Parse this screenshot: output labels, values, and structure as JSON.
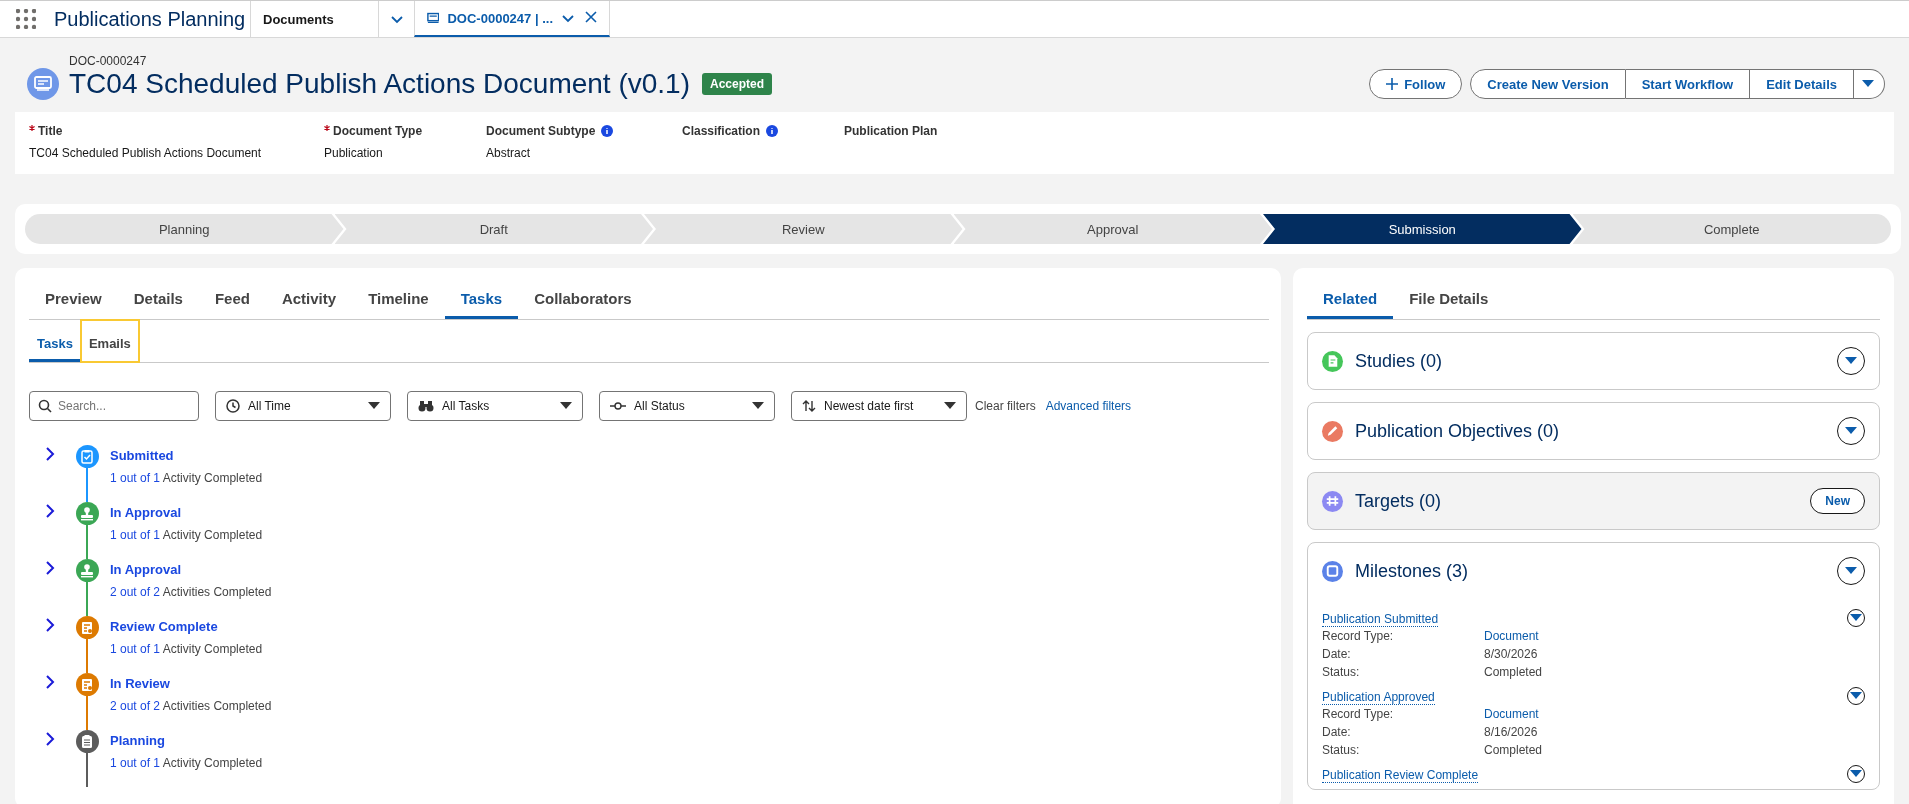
{
  "app": {
    "name": "Publications Planning",
    "nav_tabs": [
      {
        "label": "Documents",
        "kind": "object",
        "selected": false
      },
      {
        "label": "DOC-0000247 | ...",
        "kind": "record",
        "selected": true
      }
    ]
  },
  "header": {
    "record_id": "DOC-0000247",
    "title": "TC04 Scheduled Publish Actions Document (v0.1)",
    "badge": "Accepted",
    "follow": "Follow",
    "actions": [
      "Create New Version",
      "Start Workflow",
      "Edit Details"
    ]
  },
  "fields": [
    {
      "label": "Title",
      "required": true,
      "info": false,
      "value": "TC04 Scheduled Publish Actions Document"
    },
    {
      "label": "Document Type",
      "required": true,
      "info": false,
      "value": "Publication"
    },
    {
      "label": "Document Subtype",
      "required": false,
      "info": true,
      "value": "Abstract"
    },
    {
      "label": "Classification",
      "required": false,
      "info": true
    },
    {
      "label": "Publication Plan",
      "required": false,
      "info": false
    }
  ],
  "path": [
    {
      "label": "Planning",
      "selected": false
    },
    {
      "label": "Draft",
      "selected": false
    },
    {
      "label": "Review",
      "selected": false
    },
    {
      "label": "Approval",
      "selected": false
    },
    {
      "label": "Submission",
      "selected": true
    },
    {
      "label": "Complete",
      "selected": false
    }
  ],
  "main_tabs": [
    {
      "label": "Preview",
      "selected": false
    },
    {
      "label": "Details",
      "selected": false
    },
    {
      "label": "Feed",
      "selected": false
    },
    {
      "label": "Activity",
      "selected": false
    },
    {
      "label": "Timeline",
      "selected": false
    },
    {
      "label": "Tasks",
      "selected": true
    },
    {
      "label": "Collaborators",
      "selected": false
    }
  ],
  "sub_tabs": [
    {
      "label": "Tasks",
      "selected": true,
      "focused": false
    },
    {
      "label": "Emails",
      "selected": false,
      "focused": true
    }
  ],
  "filters": {
    "search": {
      "placeholder": "Search..."
    },
    "dropdowns": [
      {
        "kind": "time",
        "value": "All Time"
      },
      {
        "kind": "tasks",
        "value": "All Tasks"
      },
      {
        "kind": "status",
        "value": "All Status"
      },
      {
        "kind": "sort",
        "value": "Newest date first"
      }
    ],
    "clear": "Clear filters",
    "advanced": "Advanced filters"
  },
  "timeline": [
    {
      "kind": "submitted",
      "color": "#1b96ff",
      "title": "Submitted",
      "count": "1 out of 1",
      "summary": "Activity Completed"
    },
    {
      "kind": "approval",
      "color": "#3ba755",
      "title": "In Approval",
      "count": "1 out of 1",
      "summary": "Activity Completed"
    },
    {
      "kind": "approval",
      "color": "#3ba755",
      "title": "In Approval",
      "count": "2 out of 2",
      "summary": "Activities Completed"
    },
    {
      "kind": "review",
      "color": "#dd7a01",
      "title": "Review Complete",
      "count": "1 out of 1",
      "summary": "Activity Completed"
    },
    {
      "kind": "review",
      "color": "#dd7a01",
      "title": "In Review",
      "count": "2 out of 2",
      "summary": "Activities Completed"
    },
    {
      "kind": "planning",
      "color": "#5c5c5c",
      "title": "Planning",
      "count": "1 out of 1",
      "summary": "Activity Completed"
    }
  ],
  "side_tabs": [
    {
      "label": "Related",
      "selected": true
    },
    {
      "label": "File Details",
      "selected": false
    }
  ],
  "related": [
    {
      "kind": "study",
      "color": "#45c65a",
      "title": "Studies (0)"
    },
    {
      "kind": "objective",
      "color": "#ea7a62",
      "title": "Publication Objectives (0)"
    },
    {
      "kind": "target",
      "color": "#8c89f2",
      "title": "Targets (0)",
      "button": "New"
    },
    {
      "kind": "milestone",
      "color": "#5b82e8",
      "title": "Milestones (3)",
      "records": [
        {
          "title": "Publication Submitted",
          "fields": [
            {
              "label": "Record Type:",
              "value": "Document",
              "link": true
            },
            {
              "label": "Date:",
              "value": "8/30/2026",
              "link": false
            },
            {
              "label": "Status:",
              "value": "Completed",
              "link": false
            }
          ]
        },
        {
          "title": "Publication Approved",
          "fields": [
            {
              "label": "Record Type:",
              "value": "Document",
              "link": true
            },
            {
              "label": "Date:",
              "value": "8/16/2026",
              "link": false
            },
            {
              "label": "Status:",
              "value": "Completed",
              "link": false
            }
          ]
        },
        {
          "title": "Publication Review Complete"
        }
      ]
    }
  ]
}
